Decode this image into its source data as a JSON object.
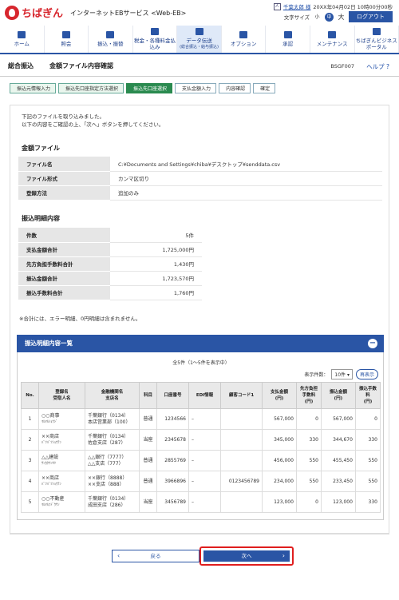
{
  "header": {
    "logo_text": "ちばぎん",
    "service": "インターネットEBサービス <Web-EB>",
    "user_name": "千葉太郎 様",
    "last_login": "20XX年04月02日 10時00分00秒",
    "font_size_label": "文字サイズ",
    "font_small": "小",
    "font_mid": "中",
    "font_big": "大",
    "logout": "ログアウト"
  },
  "nav": [
    {
      "label": "ホーム",
      "sub": ""
    },
    {
      "label": "照会",
      "sub": ""
    },
    {
      "label": "振込・振替",
      "sub": ""
    },
    {
      "label": "税金・各種料金払込み",
      "sub": ""
    },
    {
      "label": "データ伝送",
      "sub": "(総合振込・給与振込)"
    },
    {
      "label": "オプション",
      "sub": ""
    },
    {
      "label": "承認",
      "sub": ""
    },
    {
      "label": "メンテナンス",
      "sub": ""
    },
    {
      "label": "ちばぎんビジネスポータル",
      "sub": ""
    }
  ],
  "title": {
    "main": "総合振込",
    "sub": "金額ファイル内容確認",
    "code": "BSGF007",
    "help": "ヘルプ"
  },
  "steps": [
    "振込元情報入力",
    "振込先口座指定方法選択",
    "振込先口座選択",
    "支払金額入力",
    "内容確認",
    "確定"
  ],
  "message": [
    "下記のファイルを取り込みました。",
    "以下の内容をご確認の上、「次へ」ボタンを押してください。"
  ],
  "file_section": {
    "heading": "金額ファイル",
    "rows": [
      {
        "k": "ファイル名",
        "v": "C:¥Documents and Settings¥chiba¥デスクトップ¥senddata.csv"
      },
      {
        "k": "ファイル形式",
        "v": "カンマ区切り"
      },
      {
        "k": "登録方法",
        "v": "追加のみ"
      }
    ]
  },
  "detail_section": {
    "heading": "振込明細内容",
    "rows": [
      {
        "k": "件数",
        "v": "5件"
      },
      {
        "k": "支払金額合計",
        "v": "1,725,000円"
      },
      {
        "k": "先方負担手数料合計",
        "v": "1,430円"
      },
      {
        "k": "振込金額合計",
        "v": "1,723,570円"
      },
      {
        "k": "振込手数料合計",
        "v": "1,760円"
      }
    ],
    "note": "※合計には、エラー明細、0円明細は含まれません。"
  },
  "list": {
    "heading": "振込明細内容一覧",
    "count": "全5件（1～5件を表示中）",
    "per_page_label": "表示件数：",
    "per_page": "10件",
    "redisplay": "再表示",
    "headers": [
      "No.",
      "登録名\n受取人名",
      "金融機関名\n支店名",
      "科目",
      "口座番号",
      "EDI情報",
      "顧客コード1",
      "支払金額\n(円)",
      "先方負担\n手数料\n(円)",
      "振込金額\n(円)",
      "振込手数\n料\n(円)"
    ],
    "rows": [
      {
        "no": "1",
        "name": "○○商事",
        "kana": "ﾏﾙﾏﾙｼｮｳｼﾞ",
        "bank": "千葉銀行（0134）",
        "branch": "本店営業部（100）",
        "type": "普通",
        "acct": "1234566",
        "edi": "–",
        "cust": "",
        "pay": "567,000",
        "fee_bear": "0",
        "transfer": "567,000",
        "fee": "0"
      },
      {
        "no": "2",
        "name": "××商店",
        "kana": "ﾊﾞﾂﾊﾞﾂｼｮｳﾃﾝ",
        "bank": "千葉銀行（0134）",
        "branch": "佐倉支店（287）",
        "type": "当座",
        "acct": "2345678",
        "edi": "–",
        "cust": "",
        "pay": "345,000",
        "fee_bear": "330",
        "transfer": "344,670",
        "fee": "330"
      },
      {
        "no": "3",
        "name": "△△建設",
        "kana": "ｻﾝｶｸｹﾝｾﾂ",
        "bank": "△△銀行（7777）",
        "branch": "△△支店（777）",
        "type": "普通",
        "acct": "2855769",
        "edi": "–",
        "cust": "",
        "pay": "456,000",
        "fee_bear": "550",
        "transfer": "455,450",
        "fee": "550"
      },
      {
        "no": "4",
        "name": "××商店",
        "kana": "ﾊﾞﾂﾊﾞﾂｼｮｳﾃﾝ",
        "bank": "××銀行（8888）",
        "branch": "××支店（888）",
        "type": "普通",
        "acct": "3966896",
        "edi": "–",
        "cust": "0123456789",
        "pay": "234,000",
        "fee_bear": "550",
        "transfer": "233,450",
        "fee": "550"
      },
      {
        "no": "5",
        "name": "○○不動産",
        "kana": "ﾏﾙﾏﾙﾌﾄﾞｳｻﾝ",
        "bank": "千葉銀行（0134）",
        "branch": "成田支店（286）",
        "type": "当座",
        "acct": "3456789",
        "edi": "–",
        "cust": "",
        "pay": "123,000",
        "fee_bear": "0",
        "transfer": "123,000",
        "fee": "330"
      }
    ]
  },
  "buttons": {
    "back": "戻る",
    "next": "次へ"
  },
  "colors": {
    "brand_red": "#d7262d",
    "nav_blue": "#2a55a5",
    "step_green": "#2a8a4f",
    "highlight_red": "#e01e1e"
  }
}
